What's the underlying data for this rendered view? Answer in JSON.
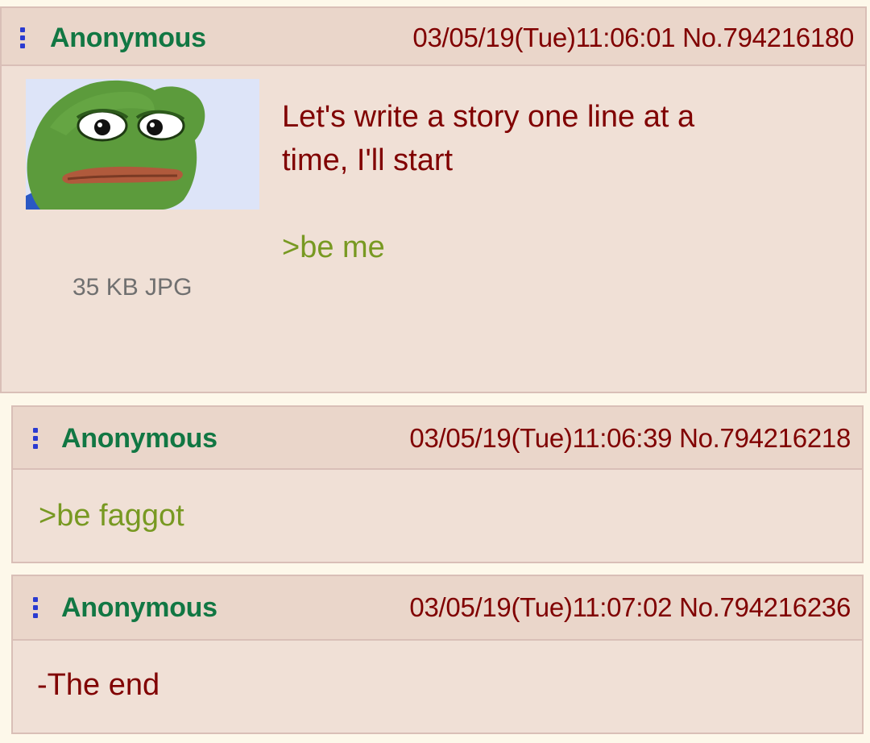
{
  "posts": [
    {
      "name": "Anonymous",
      "meta": "03/05/19(Tue)11:06:01 No.794216180",
      "lines": [
        "Let's write a story one line at a",
        "time, I'll start"
      ],
      "greentext": ">be me",
      "file_info": "35 KB JPG"
    },
    {
      "name": "Anonymous",
      "meta": "03/05/19(Tue)11:06:39 No.794216218",
      "greentext": ">be faggot"
    },
    {
      "name": "Anonymous",
      "meta": "03/05/19(Tue)11:07:02 No.794216236",
      "text": "-The end"
    }
  ],
  "icons": [
    "menu-icon",
    "pepe-thumbnail"
  ],
  "colors": {
    "page_bg": "#fdf8ea",
    "post_bg": "#f0e0d6",
    "header_bg": "#ead6ca",
    "border": "#d9bfb7",
    "name": "#117743",
    "text": "#800000",
    "greentext": "#789922",
    "menu": "#2a3bd1"
  }
}
